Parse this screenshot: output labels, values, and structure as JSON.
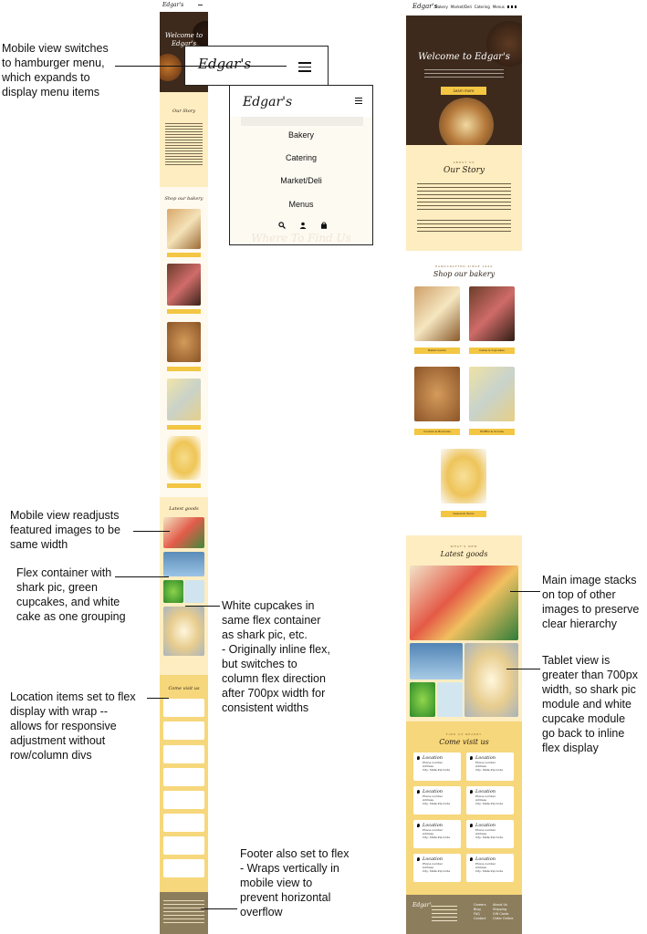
{
  "annotations": {
    "hamburger": "Mobile view switches\nto hamburger menu,\nwhich expands to\ndisplay menu items",
    "featured": "Mobile view readjusts\nfeatured images to be\nsame width",
    "flex_container": "Flex container with\nshark pic, green\ncupcakes, and white\ncake as one grouping",
    "white_cupcakes": "White cupcakes in\nsame flex container\nas shark pic, etc.\n- Originally inline flex,\nbut switches to\ncolumn flex direction\nafter 700px width for\nconsistent widths",
    "location": "Location items set to flex\ndisplay with wrap --\nallows for responsive\nadjustment without\nrow/column divs",
    "footer": "Footer also set to flex\n- Wraps vertically in\nmobile view to\nprevent horizontal\noverflow",
    "main_image": "Main image stacks\non top of other\nimages to preserve\nclear hierarchy",
    "tablet": "Tablet view is\ngreater than 700px\nwidth, so shark pic\nmodule and white\ncupcake module\ngo back to inline\nflex display"
  },
  "menu": {
    "logo": "Edgar's",
    "items": [
      "Bakery",
      "Catering",
      "Market/Deli",
      "Menus"
    ],
    "bg_text": "Where To Find Us"
  },
  "site": {
    "logo": "Edgar's",
    "nav": [
      "Bakery",
      "Market/Deli",
      "Catering",
      "Menus"
    ],
    "hero_title": "Welcome to Edgar's",
    "hero_title_mobile": "Welcome to Edgar's",
    "hero_sub": "Your old-fashioned family bakery, serving\nscratch, quality, artisan baked goods with local ingredients,\nsince our founding in 1949",
    "hero_button": "Learn more",
    "story_kicker": "ABOUT US",
    "story_title": "Our Story",
    "shop_kicker": "HANDCRAFTED SINCE 1949",
    "shop_title": "Shop our bakery",
    "shop_labels": [
      "Baked Goods",
      "Cakes & Cupcakes",
      "Cookies & Brownies",
      "Muffins & Scones",
      "Seasonal Items"
    ],
    "latest_kicker": "WHAT'S NEW",
    "latest_title": "Latest goods",
    "visit_kicker": "FIND US NEARBY",
    "visit_title": "Come visit us",
    "location_title": "Location",
    "location_lines": [
      "Phone number",
      "Address",
      "City, State Zip Code"
    ],
    "footer_nav": [
      "Careers",
      "Blog",
      "FAQ",
      "Contact"
    ],
    "footer_col2": [
      "About Us",
      "Shipping",
      "Gift Cards",
      "Order Online"
    ]
  },
  "colors": {
    "accent": "#f3c643",
    "cream": "#fdedc0",
    "dark": "#3d2a1c",
    "footer": "#8c7d5c"
  }
}
